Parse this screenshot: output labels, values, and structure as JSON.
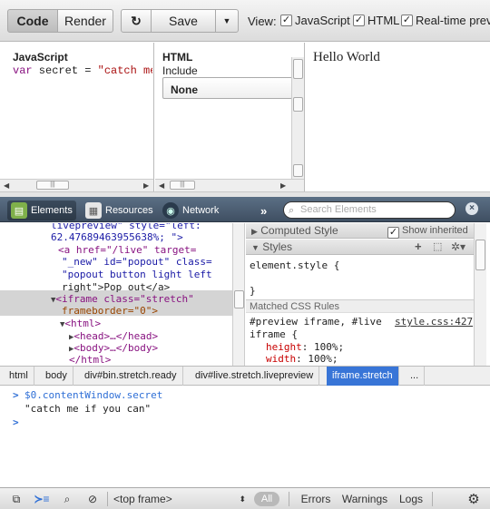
{
  "toolbar": {
    "code_label": "Code",
    "render_label": "Render",
    "undo_icon": "↻",
    "save_label": "Save",
    "save_menu_icon": "▼",
    "view_label": "View:",
    "view_options": [
      {
        "label": "JavaScript",
        "checked": true
      },
      {
        "label": "HTML",
        "checked": true
      },
      {
        "label": "Real-time prev",
        "checked": true
      }
    ]
  },
  "editor": {
    "js_title": "JavaScript",
    "js_code_var": "var",
    "js_code_rest": " secret = ",
    "js_code_string": "\"catch me i",
    "html_title": "HTML",
    "html_include_label": "Include",
    "html_include_value": "None"
  },
  "preview": {
    "text": "Hello World"
  },
  "devtools": {
    "tabs": [
      {
        "label": "Elements",
        "icon": "elements-icon",
        "active": true
      },
      {
        "label": "Resources",
        "icon": "resources-icon",
        "active": false
      },
      {
        "label": "Network",
        "icon": "network-icon",
        "active": false
      }
    ],
    "more_label": "»",
    "search_placeholder": "Search Elements",
    "close_label": "×",
    "dom_lines": [
      "livepreview\" style=\"left:",
      "62.47689463955638%; \">",
      "<a href=\"/live\" target=",
      "\"_new\" id=\"popout\" class=",
      "\"popout button light left",
      "right\">Pop out</a>",
      "<iframe class=\"stretch\"",
      "frameborder=\"0\">",
      "<html>",
      "<head>…</head>",
      "<body>…</body>",
      "</html>"
    ],
    "computed_style_label": "Computed Style",
    "show_inherited_label": "Show inherited",
    "styles_label": "Styles",
    "element_style_text": "element.style {",
    "element_style_close": "}",
    "matched_rules_label": "Matched CSS Rules",
    "rule_selector_1": "#preview iframe, #live",
    "rule_selector_2": "iframe {",
    "rule_source": "style.css:427",
    "rule_props": [
      {
        "name": "height",
        "value": "100%;"
      },
      {
        "name": "width",
        "value": "100%;"
      }
    ]
  },
  "breadcrumbs": [
    {
      "label": "html",
      "selected": false
    },
    {
      "label": "body",
      "selected": false
    },
    {
      "label": "div#bin.stretch.ready",
      "selected": false
    },
    {
      "label": "div#live.stretch.livepreview",
      "selected": false
    },
    {
      "label": "iframe.stretch",
      "selected": true
    },
    {
      "label": "...",
      "selected": false
    }
  ],
  "console": {
    "input": "$0.contentWindow.secret",
    "output": "\"catch me if you can\"",
    "prompt": ">"
  },
  "statusbar": {
    "frame_select": "<top frame>",
    "filter_all": "All",
    "filter_errors": "Errors",
    "filter_warnings": "Warnings",
    "filter_logs": "Logs"
  },
  "colors": {
    "devtools_bar": "#4a5b6e",
    "selected_crumb": "#3875d7",
    "tag": "#881280",
    "attr_name": "#994500",
    "attr_value": "#1a1aa6",
    "prompt": "#2f6fd6"
  }
}
